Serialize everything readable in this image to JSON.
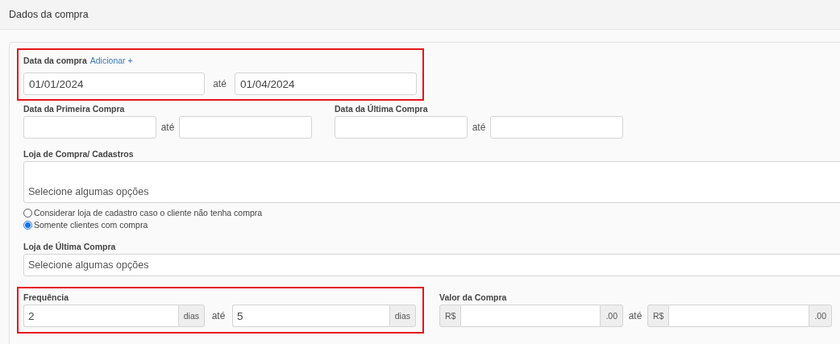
{
  "panel": {
    "title": "Dados da compra"
  },
  "purchase_date": {
    "label": "Data da compra",
    "add_link": "Adicionar +",
    "from": "01/01/2024",
    "separator": "até",
    "to": "01/04/2024",
    "highlighted": true
  },
  "date_ranges": [
    {
      "label": "Data da Primeira Compra",
      "separator": "até"
    },
    {
      "label": "Data da Última Compra",
      "separator": "até"
    }
  ],
  "store_register": {
    "label": "Loja de Compra/ Cadastros",
    "placeholder": "Selecione algumas opções"
  },
  "store_options": [
    {
      "label": "Considerar loja de cadastro caso o cliente não tenha compra",
      "selected": false
    },
    {
      "label": "Somente clientes com compra",
      "selected": true
    }
  ],
  "last_store": {
    "label": "Loja de Última Compra",
    "placeholder": "Selecione algumas opções"
  },
  "frequency": {
    "label": "Frequência",
    "from": "2",
    "from_suffix": "dias",
    "separator": "até",
    "to": "5",
    "to_suffix": "dias",
    "highlighted": true
  },
  "purchase_value": {
    "label": "Valor da Compra",
    "from_prefix": "R$",
    "from_suffix": ".00",
    "separator": "até",
    "to_prefix": "R$",
    "to_suffix": ".00"
  }
}
